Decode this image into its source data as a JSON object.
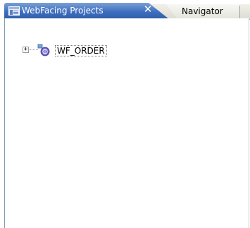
{
  "tabs": {
    "active": {
      "label": "WebFacing Projects",
      "icon": "view-icon",
      "close_glyph": "✕"
    },
    "inactive": {
      "label": "Navigator"
    }
  },
  "tree": {
    "items": [
      {
        "label": "WF_ORDER",
        "expander": "+",
        "icon": "webfacing-project-icon"
      }
    ]
  },
  "colors": {
    "active_tab": "#3e6fbf",
    "frame_border": "#7f9db9"
  }
}
